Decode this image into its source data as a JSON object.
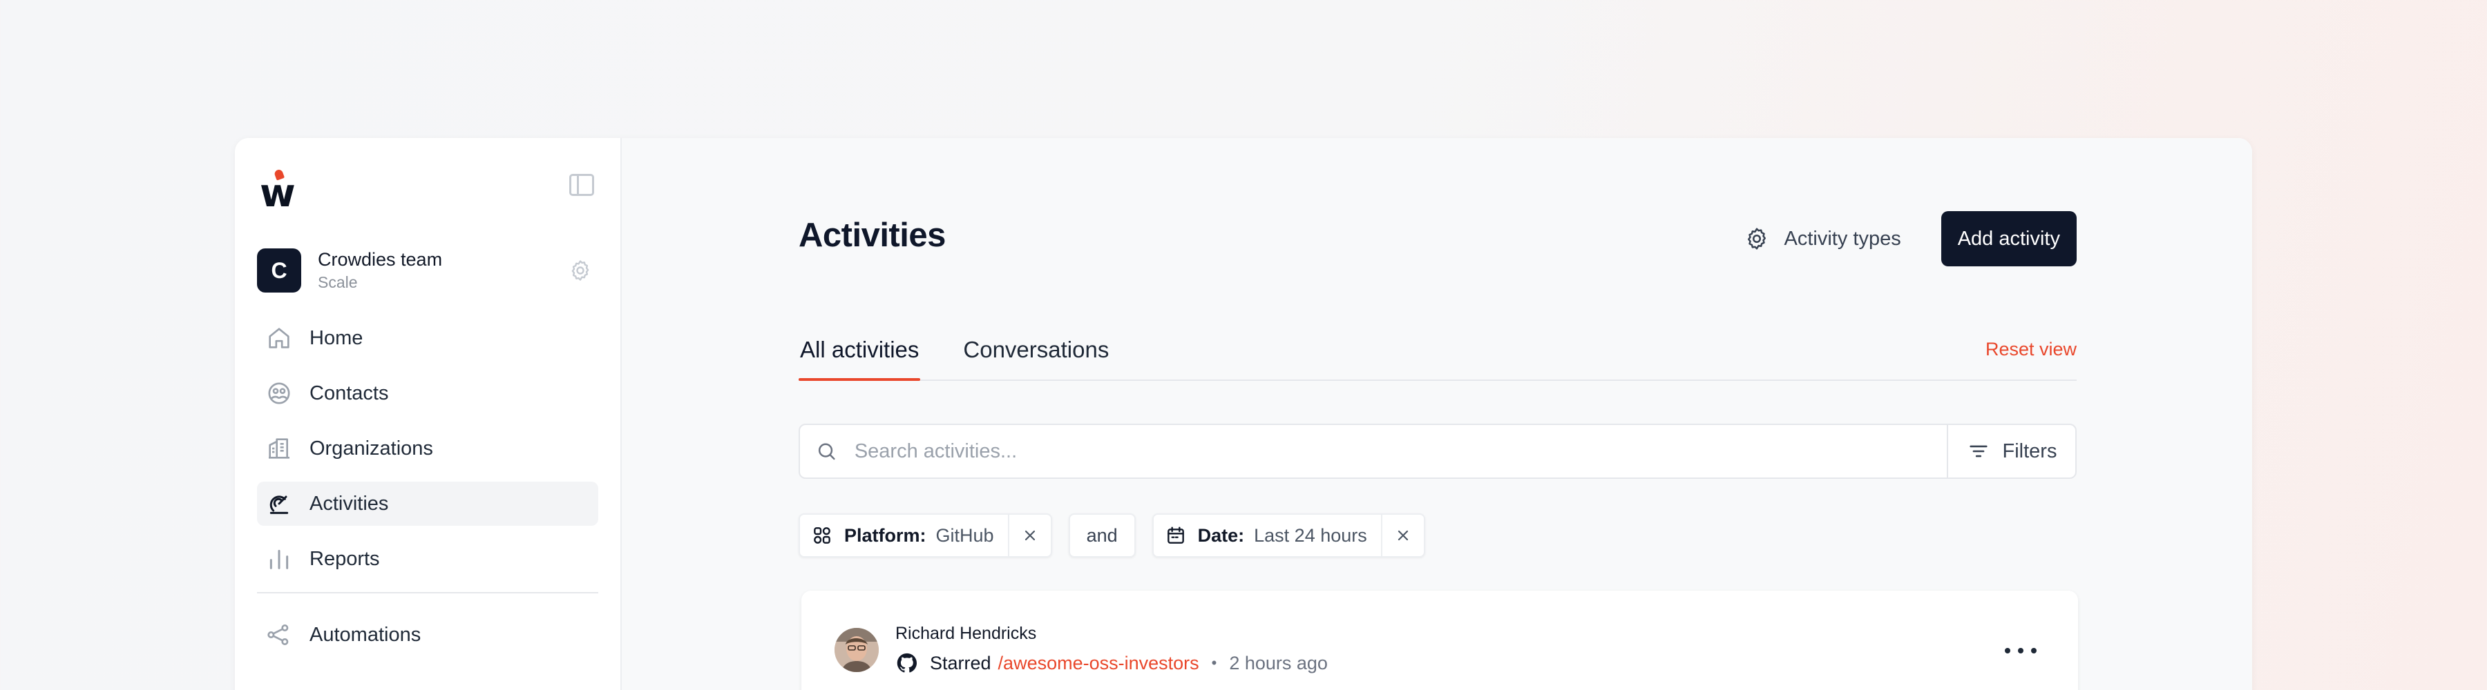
{
  "sidebar": {
    "team": {
      "initial": "C",
      "name": "Crowdies team",
      "plan": "Scale"
    },
    "items": [
      {
        "label": "Home",
        "icon": "home-icon",
        "active": false
      },
      {
        "label": "Contacts",
        "icon": "contacts-icon",
        "active": false
      },
      {
        "label": "Organizations",
        "icon": "organizations-icon",
        "active": false
      },
      {
        "label": "Activities",
        "icon": "activities-icon",
        "active": true
      },
      {
        "label": "Reports",
        "icon": "reports-icon",
        "active": false
      }
    ],
    "bottom_items": [
      {
        "label": "Automations",
        "icon": "automations-icon"
      }
    ]
  },
  "header": {
    "title": "Activities",
    "activity_types_label": "Activity types",
    "add_activity_label": "Add activity"
  },
  "tabs": [
    {
      "label": "All activities",
      "active": true
    },
    {
      "label": "Conversations",
      "active": false
    }
  ],
  "reset_view_label": "Reset view",
  "search": {
    "placeholder": "Search activities...",
    "value": ""
  },
  "filters_label": "Filters",
  "filter_chips": [
    {
      "key": "Platform:",
      "value": "GitHub",
      "icon": "platform-icon"
    },
    {
      "key": "Date:",
      "value": "Last 24 hours",
      "icon": "calendar-icon"
    }
  ],
  "chip_joiner": "and",
  "activities": [
    {
      "name": "Richard Hendricks",
      "platform_icon": "github-icon",
      "verb": "Starred",
      "target": "/awesome-oss-investors",
      "separator": "•",
      "time": "2 hours ago"
    }
  ],
  "colors": {
    "accent": "#e9472b",
    "primary": "#0f172a",
    "muted": "#9aa1ab"
  }
}
